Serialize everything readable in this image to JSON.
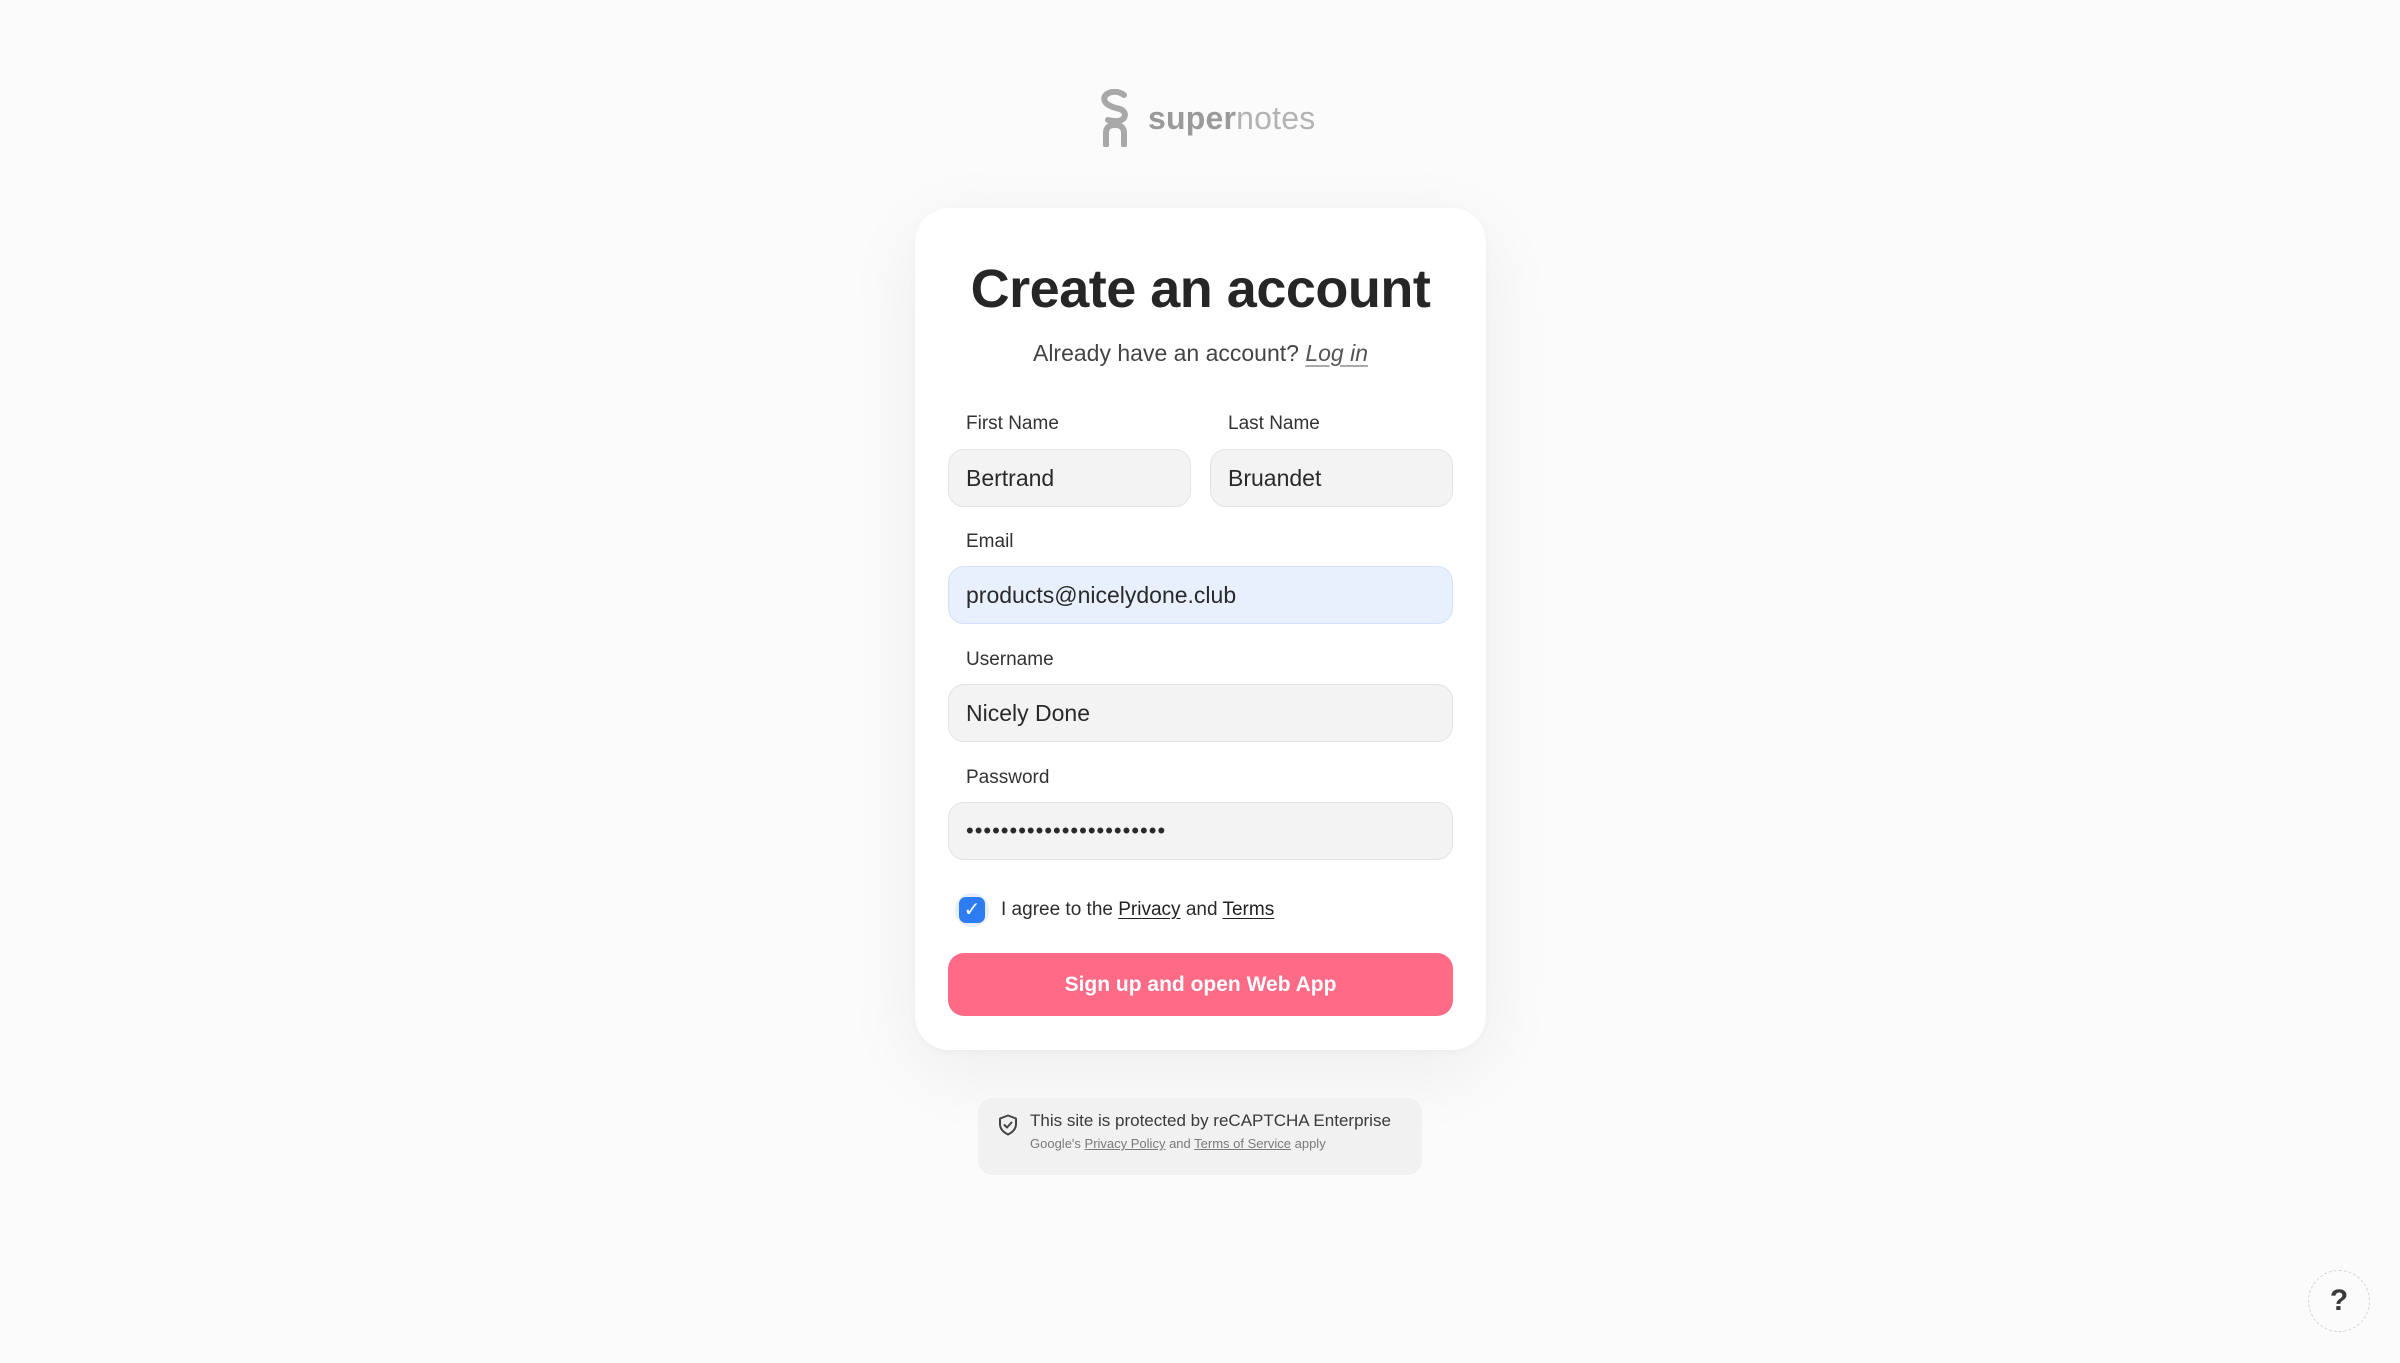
{
  "brand": {
    "name_bold": "super",
    "name_light": "notes"
  },
  "card": {
    "title": "Create an account",
    "login_prompt": "Already have an account?",
    "login_link": "Log in"
  },
  "form": {
    "first_name": {
      "label": "First Name",
      "value": "Bertrand"
    },
    "last_name": {
      "label": "Last Name",
      "value": "Bruandet"
    },
    "email": {
      "label": "Email",
      "value": "products@nicelydone.club"
    },
    "username": {
      "label": "Username",
      "value": "Nicely Done"
    },
    "password": {
      "label": "Password",
      "value": "•••••••••••••••••••••••"
    },
    "agree": {
      "checked": true,
      "prefix": "I agree to the",
      "privacy": "Privacy",
      "and": "and",
      "terms": "Terms"
    },
    "submit_label": "Sign up and open Web App"
  },
  "recaptcha": {
    "line1": "This site is protected by reCAPTCHA Enterprise",
    "prefix": "Google's",
    "privacy_policy": "Privacy Policy",
    "and": "and",
    "terms_of_service": "Terms of Service",
    "suffix": "apply"
  },
  "help": {
    "label": "?"
  },
  "colors": {
    "accent": "#ff6b87",
    "checkbox": "#2d7cf2",
    "email_focus_bg": "#e8f0fe"
  }
}
